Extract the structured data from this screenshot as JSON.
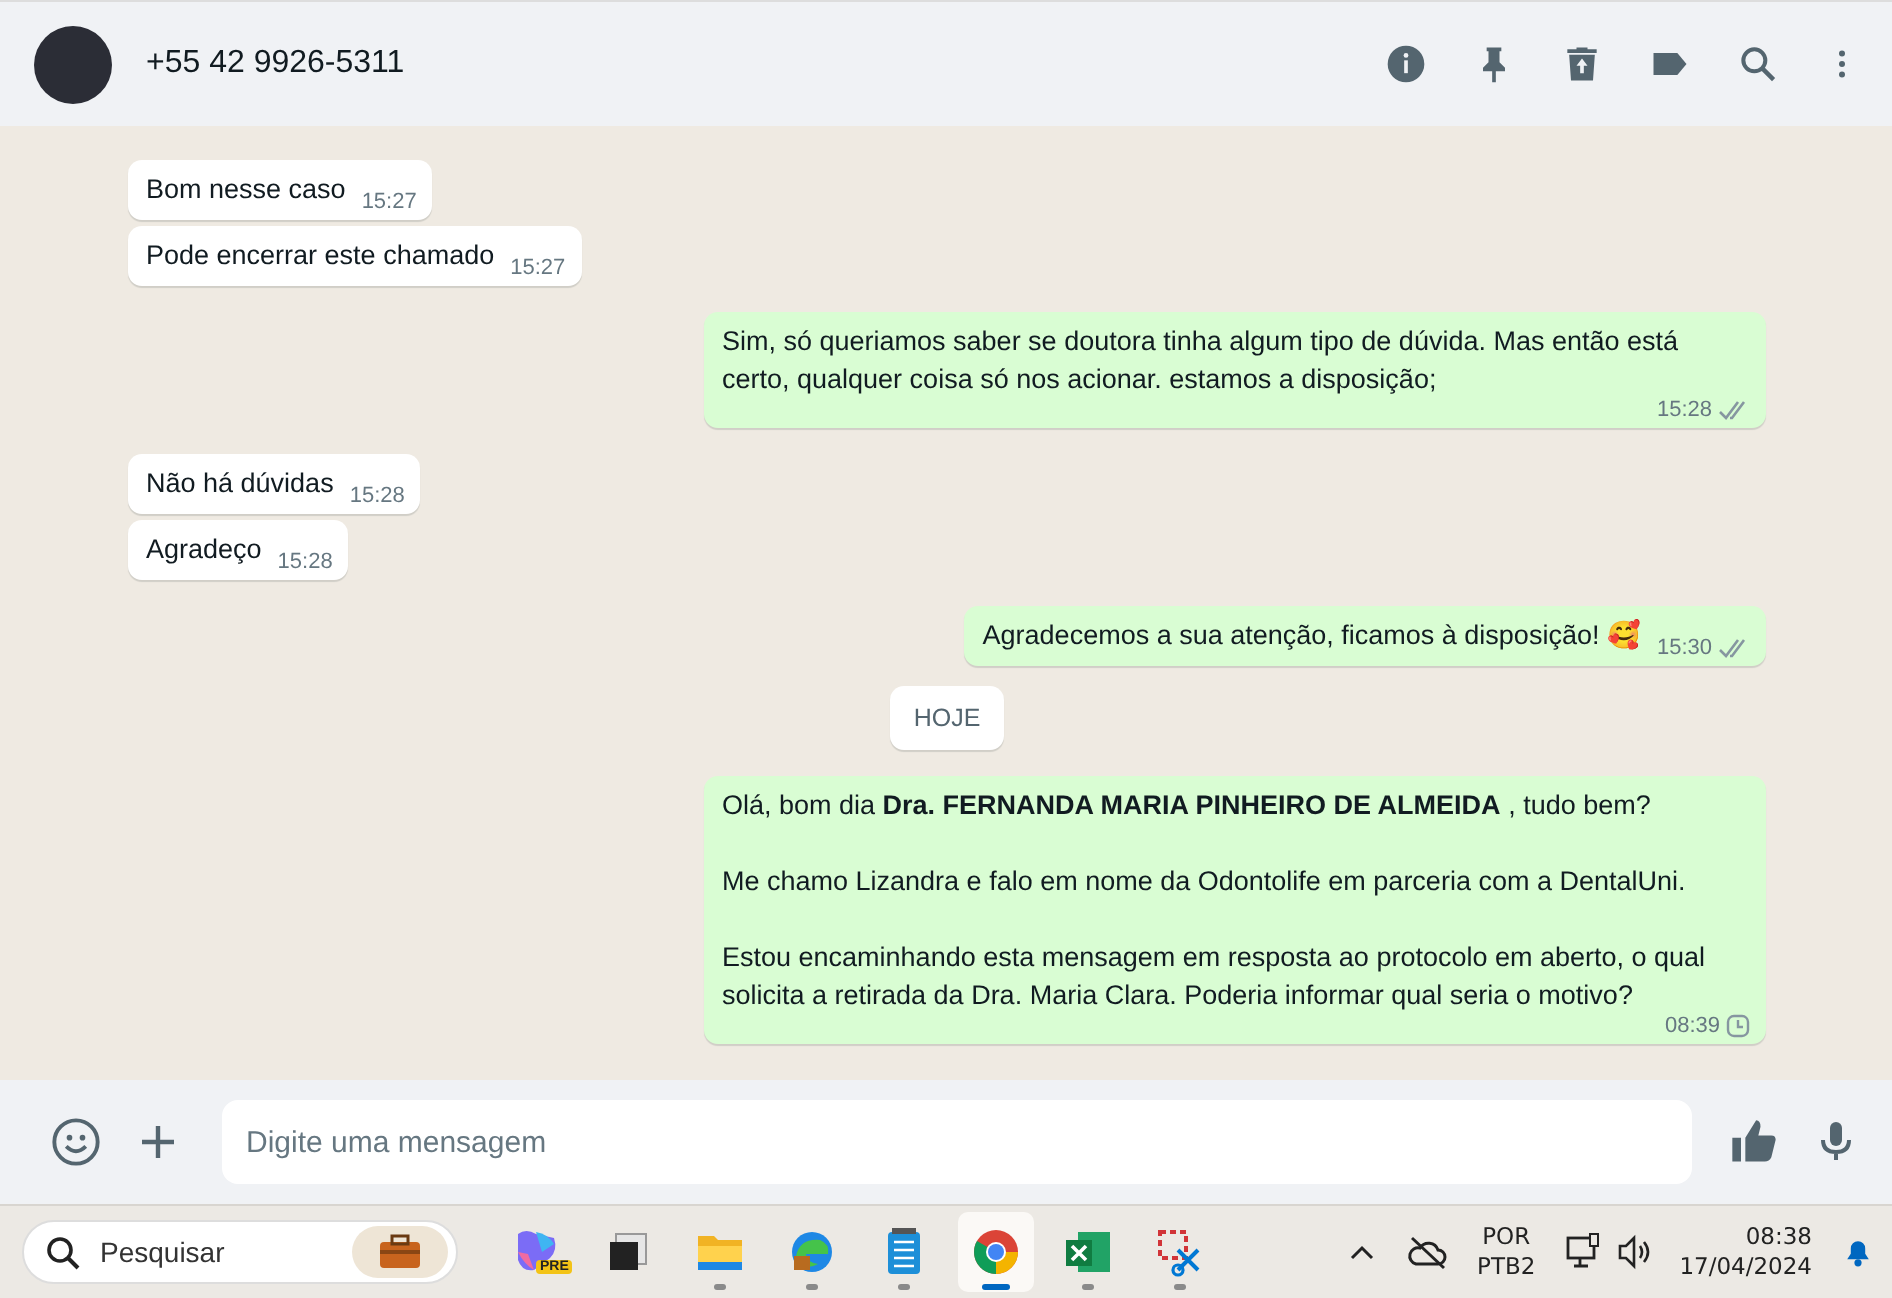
{
  "header": {
    "contact": "+55 42 9926-5311"
  },
  "messages": [
    {
      "kind": "in",
      "text": "Bom nesse caso",
      "time": "15:27"
    },
    {
      "kind": "in",
      "text": "Pode encerrar este chamado",
      "time": "15:27"
    },
    {
      "kind": "out",
      "text": "Sim, só queriamos saber se doutora tinha algum tipo de dúvida. Mas então está certo, qualquer coisa só nos acionar. estamos a disposição;",
      "time": "15:28",
      "read": true
    },
    {
      "kind": "in",
      "text": "Não há dúvidas",
      "time": "15:28"
    },
    {
      "kind": "in",
      "text": "Agradeço",
      "time": "15:28"
    },
    {
      "kind": "out",
      "text": "Agradecemos a sua atenção, ficamos à disposição! 🥰",
      "time": "15:30",
      "read": true
    },
    {
      "kind": "date",
      "text": "HOJE"
    },
    {
      "kind": "out",
      "text": "Olá, bom dia **Dra. FERNANDA MARIA PINHEIRO DE ALMEIDA** , tudo bem?\n\nMe chamo Lizandra e falo em nome da Odontolife em parceria com a DentalUni.\n\nEstou encaminhando esta mensagem em resposta ao protocolo em aberto, o qual solicita a retirada da Dra. Maria Clara. Poderia informar qual seria o motivo?",
      "time": "08:39",
      "read": false
    }
  ],
  "composer": {
    "placeholder": "Digite uma mensagem"
  },
  "taskbar": {
    "search_placeholder": "Pesquisar",
    "apps": [
      {
        "kind": "assistant",
        "badge": "PRE",
        "selected": false,
        "running": false
      },
      {
        "kind": "window",
        "selected": false,
        "running": false
      },
      {
        "kind": "folder",
        "selected": false,
        "running": true
      },
      {
        "kind": "browser",
        "selected": false,
        "running": true
      },
      {
        "kind": "notepad",
        "selected": false,
        "running": true
      },
      {
        "kind": "chrome",
        "selected": true,
        "running": true
      },
      {
        "kind": "sheet",
        "selected": false,
        "running": true
      },
      {
        "kind": "snip",
        "selected": false,
        "running": true
      }
    ],
    "language": "POR",
    "layout": "PTB2",
    "time": "08:38",
    "date": "17/04/2024"
  }
}
